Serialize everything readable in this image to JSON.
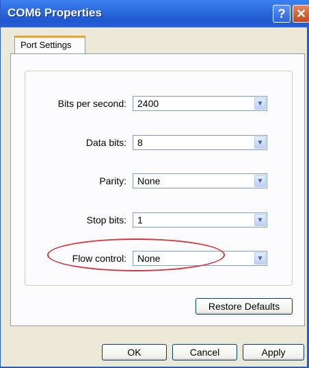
{
  "window": {
    "title": "COM6 Properties",
    "help_glyph": "?",
    "close_glyph": "✕"
  },
  "tabs": [
    {
      "label": "Port Settings"
    }
  ],
  "fields": {
    "bits_per_second": {
      "label": "Bits per second:",
      "value": "2400"
    },
    "data_bits": {
      "label": "Data bits:",
      "value": "8"
    },
    "parity": {
      "label": "Parity:",
      "value": "None"
    },
    "stop_bits": {
      "label": "Stop bits:",
      "value": "1"
    },
    "flow_control": {
      "label": "Flow control:",
      "value": "None"
    }
  },
  "dropdown_glyph": "▼",
  "buttons": {
    "restore_defaults": "Restore Defaults",
    "ok": "OK",
    "cancel": "Cancel",
    "apply": "Apply"
  },
  "annotation": {
    "highlight_color": "#d5333b"
  }
}
